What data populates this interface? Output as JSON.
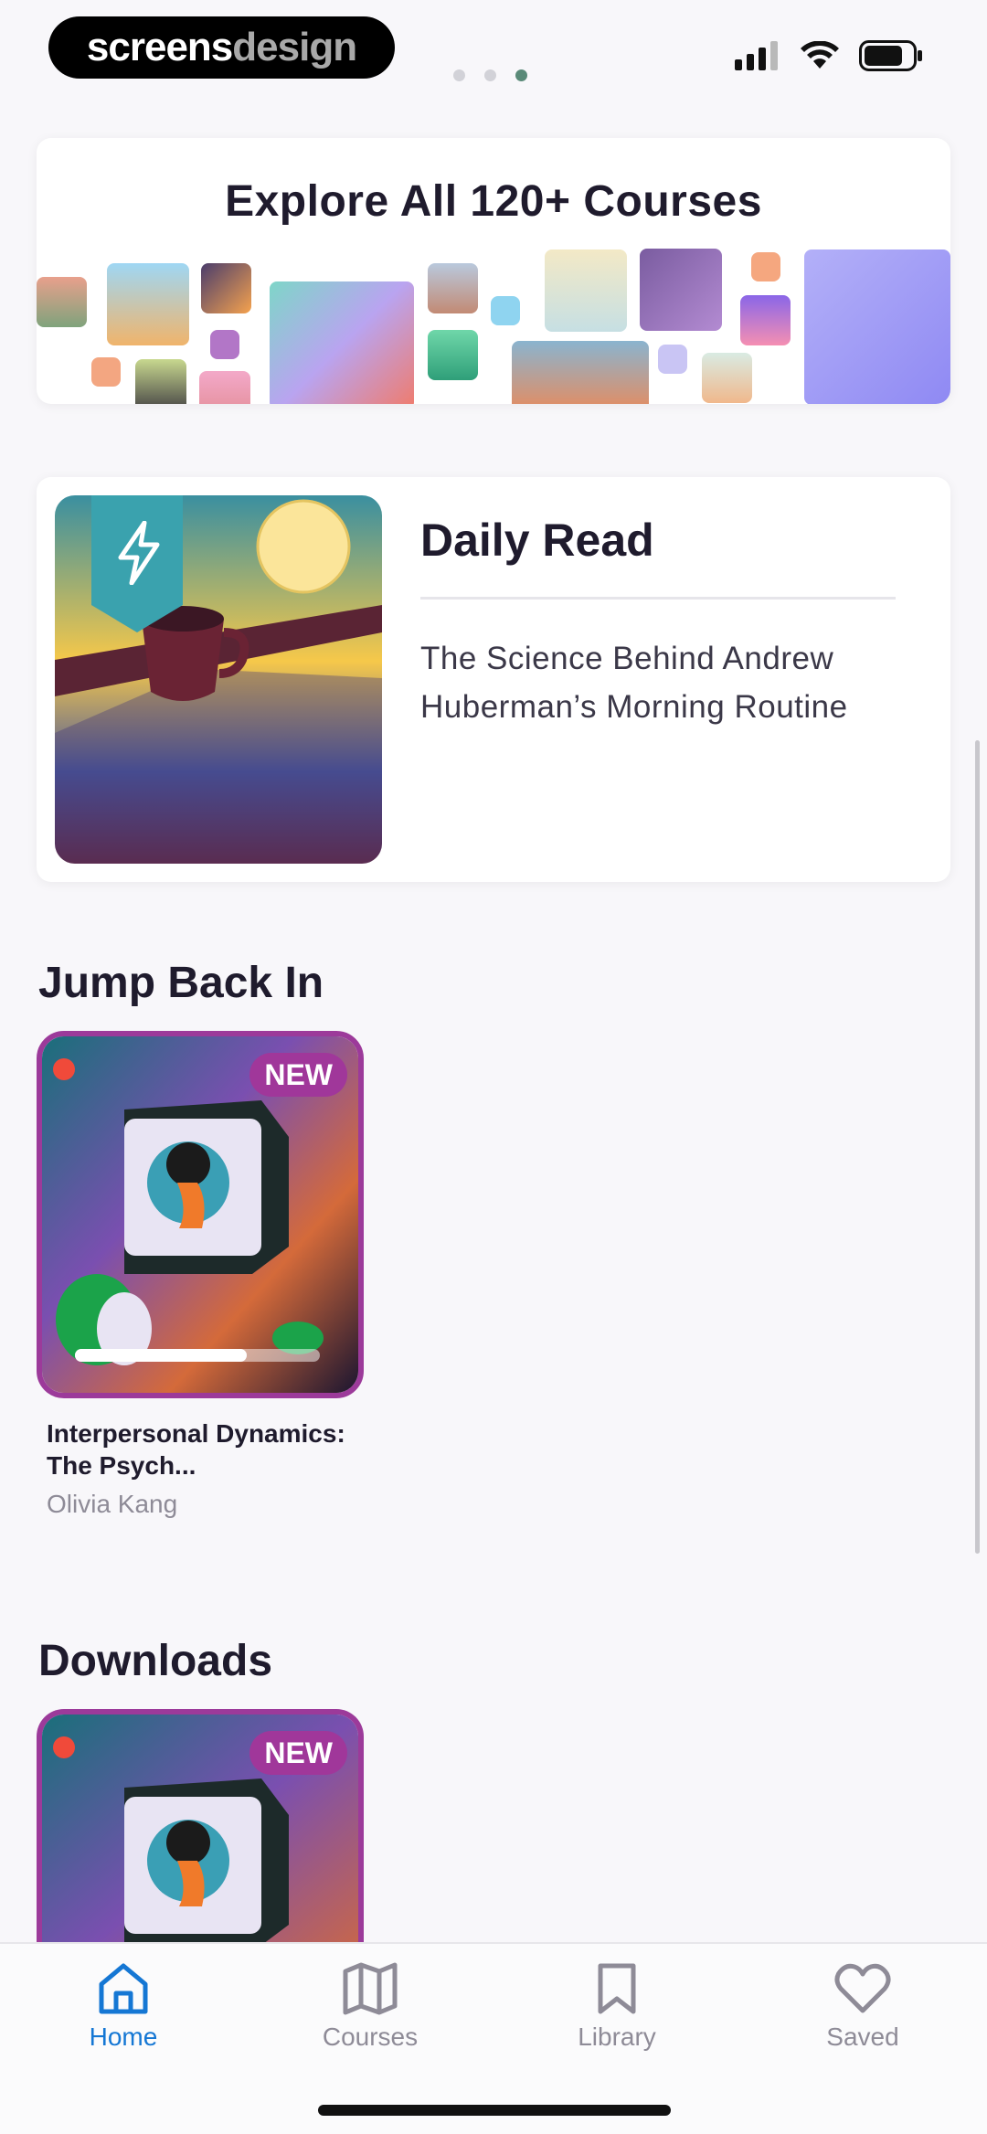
{
  "status_bar": {
    "logo_part1": "screens",
    "logo_part2": "design",
    "page_indicator": {
      "count": 3,
      "active_index": 2
    },
    "battery_level": 0.8
  },
  "explore": {
    "title": "Explore All 120+ Courses"
  },
  "daily_read": {
    "title": "Daily Read",
    "subtitle": "The Science Behind Andrew Huberman’s Morning Routine"
  },
  "jump_back_in": {
    "heading": "Jump Back In",
    "course": {
      "badge": "NEW",
      "title": "Interpersonal Dynamics: The Psych...",
      "author": "Olivia Kang",
      "progress": 0.7
    }
  },
  "downloads": {
    "heading": "Downloads",
    "course": {
      "badge": "NEW"
    }
  },
  "tab_bar": {
    "tabs": [
      {
        "label": "Home",
        "icon": "home-icon",
        "active": true
      },
      {
        "label": "Courses",
        "icon": "map-icon",
        "active": false
      },
      {
        "label": "Library",
        "icon": "bookmark-icon",
        "active": false
      },
      {
        "label": "Saved",
        "icon": "heart-icon",
        "active": false
      }
    ],
    "active_color": "#1577d4",
    "inactive_color": "#8e8b97"
  }
}
